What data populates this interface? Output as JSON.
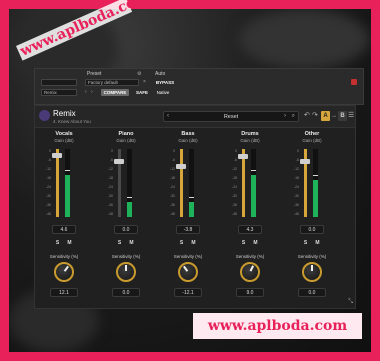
{
  "host": {
    "preset_label": "Preset",
    "auto_label": "Auto",
    "preset_value": "Factory default",
    "compare_label": "COMPARE",
    "bypass_label": "BYPASS",
    "safe_label": "SAFE",
    "native_label": "Native",
    "channel_value": "Remix"
  },
  "plugin": {
    "title": "Remix",
    "subtitle": "4. Knew About You",
    "preset": "Reset",
    "ab_a": "A",
    "ab_b": "B"
  },
  "common": {
    "gain_label": "Gain (dB)",
    "sensitivity_label": "Sensitivity (%)",
    "solo": "S",
    "mute": "M",
    "scale_marks": [
      "0",
      "-6",
      "-12",
      "-18",
      "-24",
      "-30",
      "-36",
      "-48"
    ]
  },
  "channels": [
    {
      "name": "Vocals",
      "gain": "4.6",
      "sensitivity": "12.1",
      "meter_level": 0.62,
      "active": true
    },
    {
      "name": "Piano",
      "gain": "0.0",
      "sensitivity": "0.0",
      "meter_level": 0.22,
      "active": false
    },
    {
      "name": "Bass",
      "gain": "-3.8",
      "sensitivity": "-12.1",
      "meter_level": 0.22,
      "active": true
    },
    {
      "name": "Drums",
      "gain": "4.3",
      "sensitivity": "9.0",
      "meter_level": 0.62,
      "active": true
    },
    {
      "name": "Other",
      "gain": "0.0",
      "sensitivity": "0.0",
      "meter_level": 0.55,
      "active": true
    }
  ],
  "watermark": {
    "text_top": "www.aplboda.com",
    "text_bottom": "www.aplboda.com"
  },
  "colors": {
    "frame": "#e8215a",
    "accent": "#d6a53c",
    "meter": "#1eb25a"
  }
}
